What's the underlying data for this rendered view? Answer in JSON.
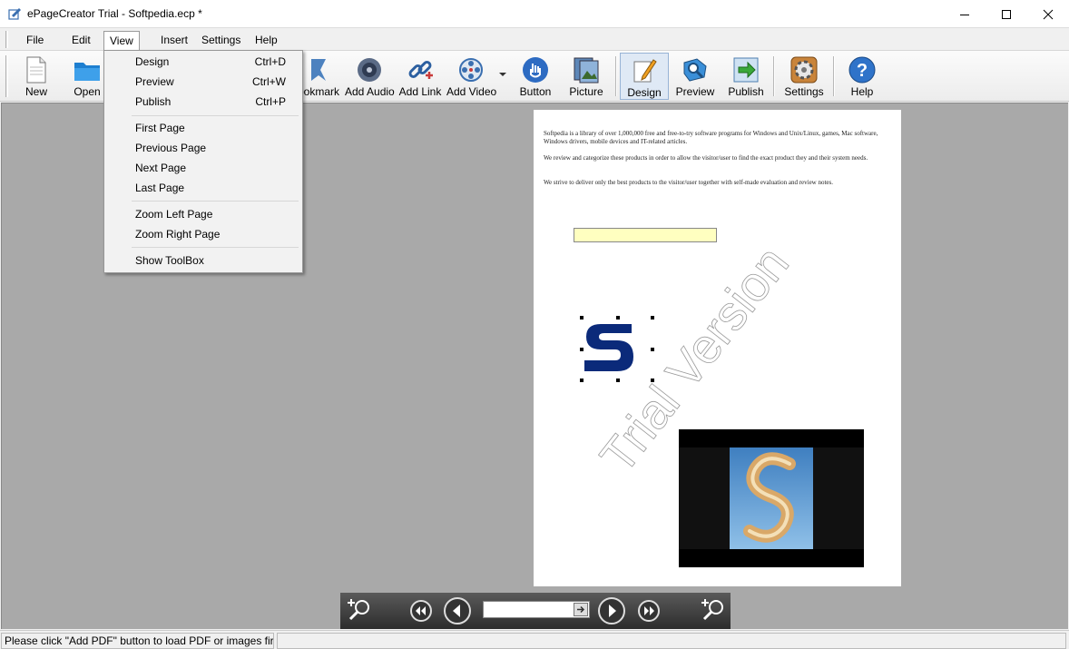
{
  "window": {
    "title": "ePageCreator Trial - Softpedia.ecp *",
    "minimize_icon": "minimize-icon",
    "maximize_icon": "maximize-icon",
    "close_icon": "close-icon"
  },
  "menubar": {
    "items": [
      {
        "label": "File"
      },
      {
        "label": "Edit"
      },
      {
        "label": "View"
      },
      {
        "label": "Insert"
      },
      {
        "label": "Settings"
      },
      {
        "label": "Help"
      }
    ],
    "open_menu": "View"
  },
  "toolbar": {
    "buttons": [
      {
        "label": "New",
        "icon": "new-document-icon"
      },
      {
        "label": "Open",
        "icon": "open-folder-icon"
      },
      {
        "label": "ookmark",
        "icon": "bookmark-icon"
      },
      {
        "label": "Add Audio",
        "icon": "speaker-icon"
      },
      {
        "label": "Add Link",
        "icon": "link-icon"
      },
      {
        "label": "Add Video",
        "icon": "film-reel-icon"
      },
      {
        "label": "Button",
        "icon": "hand-pointer-icon"
      },
      {
        "label": "Picture",
        "icon": "picture-icon"
      },
      {
        "label": "Design",
        "icon": "design-pencil-icon"
      },
      {
        "label": "Preview",
        "icon": "preview-icon"
      },
      {
        "label": "Publish",
        "icon": "publish-arrow-icon"
      },
      {
        "label": "Settings",
        "icon": "gear-icon"
      },
      {
        "label": "Help",
        "icon": "help-icon"
      }
    ],
    "active": "Design"
  },
  "view_menu": {
    "groups": [
      [
        {
          "label": "Design",
          "shortcut": "Ctrl+D"
        },
        {
          "label": "Preview",
          "shortcut": "Ctrl+W"
        },
        {
          "label": "Publish",
          "shortcut": "Ctrl+P"
        }
      ],
      [
        {
          "label": "First Page",
          "shortcut": ""
        },
        {
          "label": "Previous Page",
          "shortcut": ""
        },
        {
          "label": "Next Page",
          "shortcut": ""
        },
        {
          "label": "Last Page",
          "shortcut": ""
        }
      ],
      [
        {
          "label": "Zoom Left Page",
          "shortcut": ""
        },
        {
          "label": "Zoom Right Page",
          "shortcut": ""
        }
      ],
      [
        {
          "label": "Show ToolBox",
          "shortcut": ""
        }
      ]
    ]
  },
  "page": {
    "paragraphs": [
      "Softpedia is a library of over 1,000,000 free and free-to-try software programs for Windows and Unix/Linux, games, Mac software, Windows drivers, mobile devices and IT-related articles.",
      "We review and categorize these products in order to allow the visitor/user to find the exact product they and their system needs.",
      "We strive to deliver only the best products to the visitor/user together with self-made evaluation and review notes."
    ],
    "watermark": "Trial Version",
    "colors": {
      "logo": "#0b2a7a",
      "field": "#ffffc0"
    }
  },
  "navbar": {
    "controls": [
      "zoom-in-left-icon",
      "first-page-icon",
      "previous-page-icon",
      "page-number-input",
      "next-page-icon",
      "last-page-icon",
      "zoom-in-right-icon"
    ],
    "page_value": ""
  },
  "statusbar": {
    "text": "Please click \"Add PDF\" button to load PDF or images first"
  }
}
